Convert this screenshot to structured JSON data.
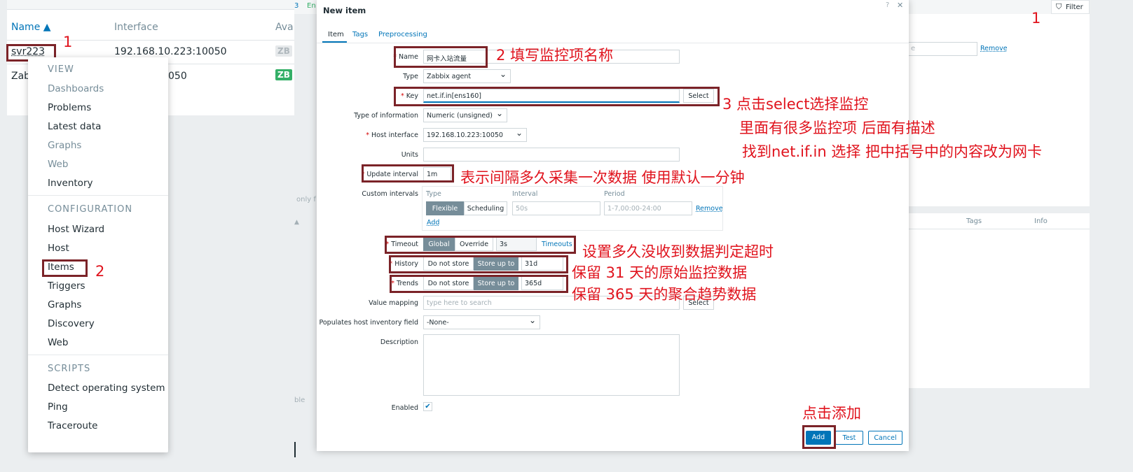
{
  "hosts_panel": {
    "columns": [
      "Name ▲",
      "Interface",
      "Ava"
    ],
    "rows": [
      {
        "name": "svr223",
        "interface": "192.168.10.223:10050",
        "badge": "ZB"
      },
      {
        "name": "Zab",
        "interface": "050",
        "badge": "ZB"
      }
    ]
  },
  "host_menu": {
    "sections": [
      {
        "header": "VIEW",
        "items": [
          "Dashboards",
          "Problems",
          "Latest data",
          "Graphs",
          "Web",
          "Inventory"
        ]
      },
      {
        "header": "CONFIGURATION",
        "items": [
          "Host Wizard",
          "Host",
          "Items",
          "Triggers",
          "Graphs",
          "Discovery",
          "Web"
        ]
      },
      {
        "header": "SCRIPTS",
        "items": [
          "Detect operating system",
          "Ping",
          "Traceroute"
        ]
      }
    ]
  },
  "background": {
    "filter_label": "Filter",
    "remove_label": "Remove",
    "tags_col": "Tags",
    "info_col": "Info",
    "only_text": "only f",
    "left_top_3": "3",
    "left_top_en": "En",
    "ble_text": "ble",
    "input_ph": "e"
  },
  "dialog": {
    "title": "New item",
    "help": "?",
    "close": "✕",
    "tabs": [
      "Item",
      "Tags",
      "Preprocessing"
    ],
    "fields": {
      "name": {
        "label": "Name",
        "value": "网卡入站流量"
      },
      "type": {
        "label": "Type",
        "value": "Zabbix agent"
      },
      "key": {
        "label": "Key",
        "value": "net.if.in[ens160]",
        "button": "Select"
      },
      "type_of_info": {
        "label": "Type of information",
        "value": "Numeric (unsigned)"
      },
      "host_interface": {
        "label": "Host interface",
        "value": "192.168.10.223:10050"
      },
      "units": {
        "label": "Units",
        "value": ""
      },
      "update_interval": {
        "label": "Update interval",
        "value": "1m"
      },
      "custom_intervals": {
        "label": "Custom intervals",
        "col_type": "Type",
        "col_interval": "Interval",
        "col_period": "Period",
        "flexible": "Flexible",
        "scheduling": "Scheduling",
        "interval_ph": "50s",
        "period_ph": "1-7,00:00-24:00",
        "remove": "Remove",
        "add": "Add"
      },
      "timeout": {
        "label": "Timeout",
        "global": "Global",
        "override": "Override",
        "value": "3s",
        "link": "Timeouts"
      },
      "history": {
        "label": "History",
        "do_not_store": "Do not store",
        "store_up_to": "Store up to",
        "value": "31d"
      },
      "trends": {
        "label": "Trends",
        "do_not_store": "Do not store",
        "store_up_to": "Store up to",
        "value": "365d"
      },
      "value_mapping": {
        "label": "Value mapping",
        "placeholder": "type here to search",
        "button": "Select"
      },
      "inventory": {
        "label": "Populates host inventory field",
        "value": "-None-"
      },
      "description": {
        "label": "Description",
        "value": ""
      },
      "enabled": {
        "label": "Enabled",
        "checked": "✔"
      }
    },
    "buttons": {
      "add": "Add",
      "test": "Test",
      "cancel": "Cancel"
    }
  },
  "annotations": {
    "n1": "1",
    "n1_right": "1",
    "n2": "2",
    "name_note": "2 填写监控项名称",
    "key_note_1": "3 点击select选择监控",
    "key_note_2": "里面有很多监控项 后面有描述",
    "key_note_3": "找到net.if.in 选择 把中括号中的内容改为网卡",
    "interval_note": "表示间隔多久采集一次数据 使用默认一分钟",
    "timeout_note": "设置多久没收到数据判定超时",
    "history_note": "保留 31 天的原始监控数据",
    "trends_note": "保留 365 天的聚合趋势数据",
    "add_note": "点击添加"
  },
  "colors": {
    "accent": "#0275b8",
    "annotation": "#e0131d",
    "box": "#7b2328",
    "segment_on": "#768d99"
  }
}
